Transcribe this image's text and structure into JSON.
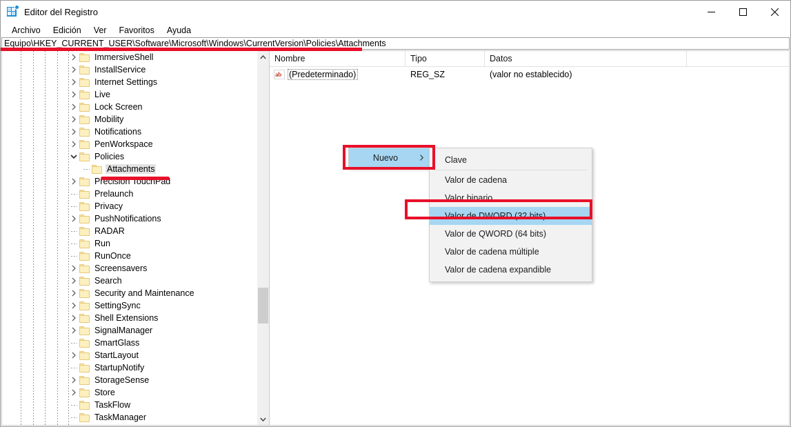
{
  "window": {
    "title": "Editor del Registro",
    "app_icon": "registry-editor-icon",
    "controls": {
      "minimize": "Minimizar",
      "maximize": "Maximizar",
      "close": "Cerrar"
    }
  },
  "menubar": {
    "items": [
      {
        "label": "Archivo"
      },
      {
        "label": "Edición"
      },
      {
        "label": "Ver"
      },
      {
        "label": "Favoritos"
      },
      {
        "label": "Ayuda"
      }
    ]
  },
  "address": {
    "path": "Equipo\\HKEY_CURRENT_USER\\Software\\Microsoft\\Windows\\CurrentVersion\\Policies\\Attachments"
  },
  "tree": {
    "items": [
      {
        "label": "ImmersiveShell",
        "expander": "collapsed",
        "indent": 0,
        "selected": false
      },
      {
        "label": "InstallService",
        "expander": "collapsed",
        "indent": 0,
        "selected": false
      },
      {
        "label": "Internet Settings",
        "expander": "collapsed",
        "indent": 0,
        "selected": false
      },
      {
        "label": "Live",
        "expander": "collapsed",
        "indent": 0,
        "selected": false
      },
      {
        "label": "Lock Screen",
        "expander": "collapsed",
        "indent": 0,
        "selected": false
      },
      {
        "label": "Mobility",
        "expander": "collapsed",
        "indent": 0,
        "selected": false
      },
      {
        "label": "Notifications",
        "expander": "collapsed",
        "indent": 0,
        "selected": false
      },
      {
        "label": "PenWorkspace",
        "expander": "collapsed",
        "indent": 0,
        "selected": false
      },
      {
        "label": "Policies",
        "expander": "expanded",
        "indent": 0,
        "selected": false
      },
      {
        "label": "Attachments",
        "expander": "none",
        "indent": 1,
        "selected": true
      },
      {
        "label": "Precision TouchPad",
        "expander": "collapsed",
        "indent": 0,
        "selected": false
      },
      {
        "label": "Prelaunch",
        "expander": "none",
        "indent": 0,
        "selected": false
      },
      {
        "label": "Privacy",
        "expander": "none",
        "indent": 0,
        "selected": false
      },
      {
        "label": "PushNotifications",
        "expander": "collapsed",
        "indent": 0,
        "selected": false
      },
      {
        "label": "RADAR",
        "expander": "none",
        "indent": 0,
        "selected": false
      },
      {
        "label": "Run",
        "expander": "none",
        "indent": 0,
        "selected": false
      },
      {
        "label": "RunOnce",
        "expander": "none",
        "indent": 0,
        "selected": false
      },
      {
        "label": "Screensavers",
        "expander": "collapsed",
        "indent": 0,
        "selected": false
      },
      {
        "label": "Search",
        "expander": "collapsed",
        "indent": 0,
        "selected": false
      },
      {
        "label": "Security and Maintenance",
        "expander": "collapsed",
        "indent": 0,
        "selected": false
      },
      {
        "label": "SettingSync",
        "expander": "collapsed",
        "indent": 0,
        "selected": false
      },
      {
        "label": "Shell Extensions",
        "expander": "collapsed",
        "indent": 0,
        "selected": false
      },
      {
        "label": "SignalManager",
        "expander": "collapsed",
        "indent": 0,
        "selected": false
      },
      {
        "label": "SmartGlass",
        "expander": "none",
        "indent": 0,
        "selected": false
      },
      {
        "label": "StartLayout",
        "expander": "collapsed",
        "indent": 0,
        "selected": false
      },
      {
        "label": "StartupNotify",
        "expander": "none",
        "indent": 0,
        "selected": false
      },
      {
        "label": "StorageSense",
        "expander": "collapsed",
        "indent": 0,
        "selected": false
      },
      {
        "label": "Store",
        "expander": "collapsed",
        "indent": 0,
        "selected": false
      },
      {
        "label": "TaskFlow",
        "expander": "none",
        "indent": 0,
        "selected": false
      },
      {
        "label": "TaskManager",
        "expander": "none",
        "indent": 0,
        "selected": false
      }
    ]
  },
  "list": {
    "columns": [
      {
        "label": "Nombre"
      },
      {
        "label": "Tipo"
      },
      {
        "label": "Datos"
      }
    ],
    "rows": [
      {
        "icon": "string-value-icon",
        "name": "(Predeterminado)",
        "type": "REG_SZ",
        "data": "(valor no establecido)"
      }
    ]
  },
  "context_menu": {
    "parent": {
      "label": "Nuevo",
      "highlighted": true,
      "submenu_arrow": "chevron-right-icon"
    },
    "submenu": [
      {
        "label": "Clave",
        "highlighted": false,
        "separator_after": true
      },
      {
        "label": "Valor de cadena",
        "highlighted": false,
        "separator_after": false
      },
      {
        "label": "Valor binario",
        "highlighted": false,
        "separator_after": false
      },
      {
        "label": "Valor de DWORD (32 bits)",
        "highlighted": true,
        "separator_after": false
      },
      {
        "label": "Valor de QWORD (64 bits)",
        "highlighted": false,
        "separator_after": false
      },
      {
        "label": "Valor de cadena múltiple",
        "highlighted": false,
        "separator_after": false
      },
      {
        "label": "Valor de cadena expandible",
        "highlighted": false,
        "separator_after": false
      }
    ]
  },
  "annotations": {
    "color": "#e8102a",
    "items": [
      {
        "name": "address-bar-underline",
        "kind": "line"
      },
      {
        "name": "attachments-underline",
        "kind": "line"
      },
      {
        "name": "nuevo-highlight-box",
        "kind": "box"
      },
      {
        "name": "dword-highlight-box",
        "kind": "box"
      }
    ]
  },
  "colors": {
    "selection_blue": "#a6d6f2",
    "tree_selection_gray": "#e3e3e3",
    "folder_yellow": "#fdf0c0",
    "accent_red": "#e8102a"
  }
}
